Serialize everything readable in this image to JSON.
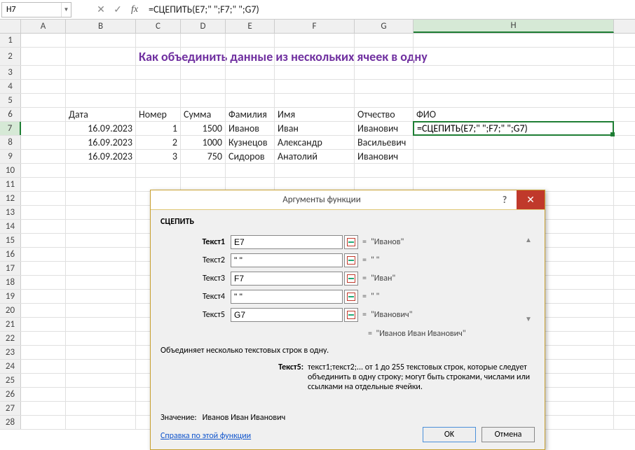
{
  "nameBox": "H7",
  "formulaBar": "=СЦЕПИТЬ(E7;\" \";F7;\" \";G7)",
  "columns": [
    "A",
    "B",
    "C",
    "D",
    "E",
    "F",
    "G",
    "H"
  ],
  "selectedCol": "H",
  "selectedRow": 7,
  "rowCount": 28,
  "title": "Как объединить данные из нескольких ячеек в одну",
  "headers": {
    "B": "Дата",
    "C": "Номер",
    "D": "Сумма",
    "E": "Фамилия",
    "F": "Имя",
    "G": "Отчество",
    "H": "ФИО"
  },
  "rows": [
    {
      "B": "16.09.2023",
      "C": "1",
      "D": "1500",
      "E": "Иванов",
      "F": "Иван",
      "G": "Иванович"
    },
    {
      "B": "16.09.2023",
      "C": "2",
      "D": "1000",
      "E": "Кузнецов",
      "F": "Александр",
      "G": "Васильевич"
    },
    {
      "B": "16.09.2023",
      "C": "3",
      "D": "750",
      "E": "Сидоров",
      "F": "Анатолий",
      "G": "Иванович"
    }
  ],
  "activeCellFormula": "=СЦЕПИТЬ(E7;\" \";F7;\" \";G7)",
  "dialog": {
    "title": "Аргументы функции",
    "funcName": "СЦЕПИТЬ",
    "args": [
      {
        "label": "Текст1",
        "bold": true,
        "value": "E7",
        "result": "\"Иванов\""
      },
      {
        "label": "Текст2",
        "bold": false,
        "value": "\" \"",
        "result": "\" \""
      },
      {
        "label": "Текст3",
        "bold": false,
        "value": "F7",
        "result": "\"Иван\""
      },
      {
        "label": "Текст4",
        "bold": false,
        "value": "\" \"",
        "result": "\" \""
      },
      {
        "label": "Текст5",
        "bold": false,
        "value": "G7",
        "result": "\"Иванович\""
      }
    ],
    "scrollUp": "▲",
    "scrollDown": "▼",
    "finalEq": "=",
    "finalResult": "\"Иванов Иван Иванович\"",
    "desc": "Объединяет несколько текстовых строк в одну.",
    "argHelpLabel": "Текст5:",
    "argHelpText": "текст1;текст2;... от 1 до 255 текстовых строк, которые следует объединить в одну строку; могут быть строками, числами или ссылками на отдельные ячейки.",
    "valueLabel": "Значение:",
    "valueText": "Иванов Иван Иванович",
    "helpLink": "Справка по этой функции",
    "okLabel": "OK",
    "cancelLabel": "Отмена",
    "helpBtn": "?",
    "closeBtn": "✕"
  },
  "fx": "fx",
  "cancelIcon": "✕",
  "acceptIcon": "✓",
  "ddIcon": "▼"
}
